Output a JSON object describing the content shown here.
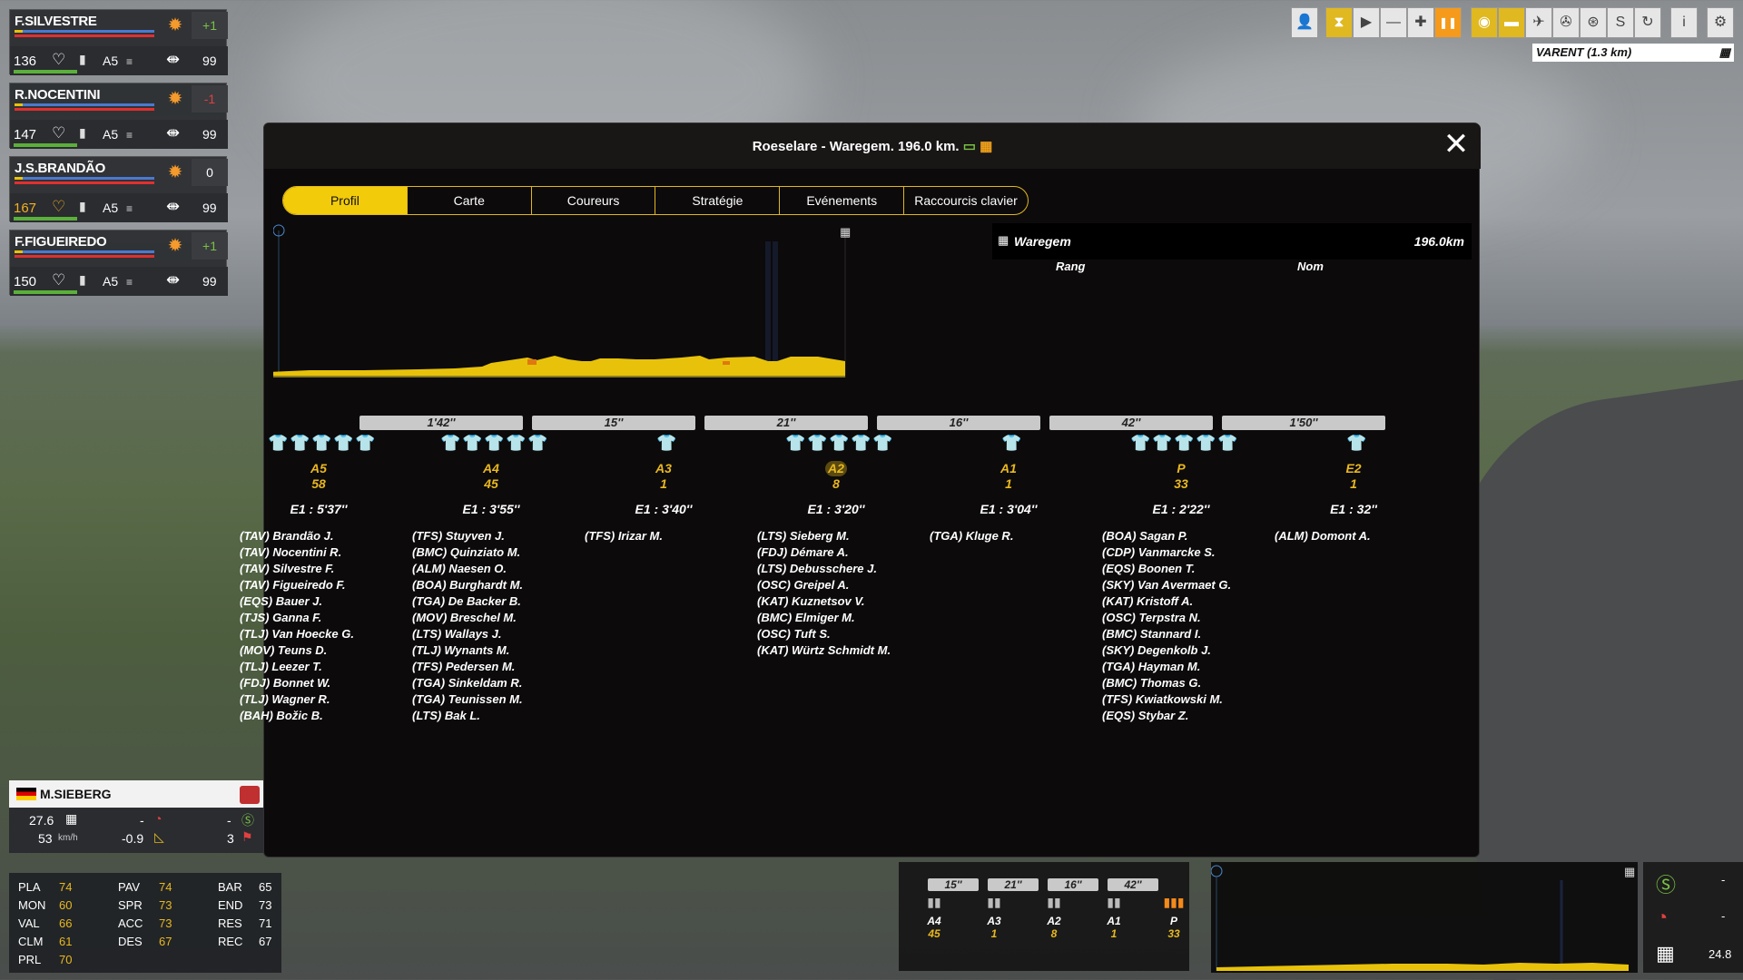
{
  "riders": [
    {
      "name": "F.SILVESTRE",
      "delta": "+1",
      "energy": "136",
      "energy_color": "#ffffff",
      "pos": "A5",
      "num": "99"
    },
    {
      "name": "R.NOCENTINI",
      "delta": "-1",
      "energy": "147",
      "energy_color": "#ffffff",
      "pos": "A5",
      "num": "99"
    },
    {
      "name": "J.S.BRANDÃO",
      "delta": "0",
      "energy": "167",
      "energy_color": "#f5b020",
      "pos": "A5",
      "num": "99"
    },
    {
      "name": "F.FIGUEIREDO",
      "delta": "+1",
      "energy": "150",
      "energy_color": "#ffffff",
      "pos": "A5",
      "num": "99"
    }
  ],
  "toolbar": {
    "icons": [
      "person-icon",
      "hourglass-icon",
      "play-icon",
      "minus-icon",
      "plus-icon",
      "pause-icon",
      "eye-icon",
      "moto-icon",
      "bike-icon",
      "helicopter-icon",
      "wheel-icon",
      "s-icon",
      "refresh-icon",
      "info-icon",
      "gear-icon"
    ],
    "location": "VARENT (1.3 km)"
  },
  "modal": {
    "title": "Roeselare - Waregem. 196.0 km.",
    "tabs": [
      "Profil",
      "Carte",
      "Coureurs",
      "Stratégie",
      "Evénements",
      "Raccourcis clavier"
    ],
    "active_tab": "Profil",
    "finish_name": "Waregem",
    "finish_km": "196.0km",
    "col_rang": "Rang",
    "col_nom": "Nom"
  },
  "gaps": [
    "1'42''",
    "15''",
    "21''",
    "16''",
    "42''",
    "1'50''"
  ],
  "groups": [
    {
      "label": "A5",
      "count": "58",
      "time": "E1 : 5'37''",
      "jerseys": 5,
      "riders": [
        "(TAV) Brandão J.",
        "(TAV) Nocentini R.",
        "(TAV) Silvestre F.",
        "(TAV) Figueiredo F.",
        "(EQS) Bauer J.",
        "(TJS) Ganna F.",
        "(TLJ) Van Hoecke G.",
        "(MOV) Teuns D.",
        "(TLJ) Leezer T.",
        "(FDJ) Bonnet W.",
        "(TLJ) Wagner R.",
        "(BAH) Božic B."
      ]
    },
    {
      "label": "A4",
      "count": "45",
      "time": "E1 : 3'55''",
      "jerseys": 5,
      "riders": [
        "(TFS) Stuyven J.",
        "(BMC) Quinziato M.",
        "(ALM) Naesen O.",
        "(BOA) Burghardt M.",
        "(TGA) De Backer B.",
        "(MOV) Breschel M.",
        "(LTS) Wallays J.",
        "(TLJ) Wynants M.",
        "(TFS) Pedersen M.",
        "(TGA) Sinkeldam R.",
        "(TGA) Teunissen M.",
        "(LTS) Bak L."
      ]
    },
    {
      "label": "A3",
      "count": "1",
      "time": "E1 : 3'40''",
      "jerseys": 1,
      "riders": [
        "(TFS) Irizar M."
      ]
    },
    {
      "label": "A2",
      "count": "8",
      "time": "E1 : 3'20''",
      "jerseys": 5,
      "riders": [
        "(LTS) Sieberg M.",
        "(FDJ) Démare A.",
        "(LTS) Debusschere J.",
        "(OSC) Greipel A.",
        "(KAT) Kuznetsov V.",
        "(BMC) Elmiger M.",
        "(OSC) Tuft S.",
        "(KAT) Würtz Schmidt M."
      ]
    },
    {
      "label": "A1",
      "count": "1",
      "time": "E1 : 3'04''",
      "jerseys": 1,
      "riders": [
        "(TGA) Kluge R."
      ]
    },
    {
      "label": "P",
      "count": "33",
      "time": "E1 : 2'22''",
      "jerseys": 5,
      "riders": [
        "(BOA) Sagan P.",
        "(CDP) Vanmarcke S.",
        "(EQS) Boonen T.",
        "(SKY) Van Avermaet G.",
        "(KAT) Kristoff A.",
        "(OSC) Terpstra N.",
        "(BMC) Stannard I.",
        "(SKY) Degenkolb J.",
        "(TGA) Hayman M.",
        "(BMC) Thomas G.",
        "(TFS) Kwiatkowski M.",
        "(EQS) Stybar Z."
      ]
    },
    {
      "label": "E2",
      "count": "1",
      "time": "E1 : 32''",
      "jerseys": 1,
      "riders": [
        "(ALM) Domont A."
      ]
    }
  ],
  "me": {
    "name": "M.SIEBERG",
    "dist": "27.6",
    "speed": "53",
    "speed_unit": "km/h",
    "a": "-",
    "grade": "-0.9",
    "b": "-",
    "c": "3",
    "stats": [
      [
        "PLA",
        "74"
      ],
      [
        "PAV",
        "74"
      ],
      [
        "BAR",
        "65"
      ],
      [
        "MON",
        "60"
      ],
      [
        "SPR",
        "73"
      ],
      [
        "END",
        "73"
      ],
      [
        "VAL",
        "66"
      ],
      [
        "ACC",
        "73"
      ],
      [
        "RES",
        "71"
      ],
      [
        "CLM",
        "61"
      ],
      [
        "DES",
        "67"
      ],
      [
        "REC",
        "67"
      ],
      [
        "PRL",
        "70"
      ]
    ]
  },
  "mini": {
    "gaps": [
      "15''",
      "21''",
      "16''",
      "42''"
    ],
    "groups": [
      {
        "label": "A4",
        "count": "45"
      },
      {
        "label": "A3",
        "count": "1"
      },
      {
        "label": "A2",
        "count": "8"
      },
      {
        "label": "A1",
        "count": "1"
      },
      {
        "label": "P",
        "count": "33"
      }
    ]
  },
  "side": {
    "s": "-",
    "mountain": "-",
    "finish": "24.8"
  }
}
